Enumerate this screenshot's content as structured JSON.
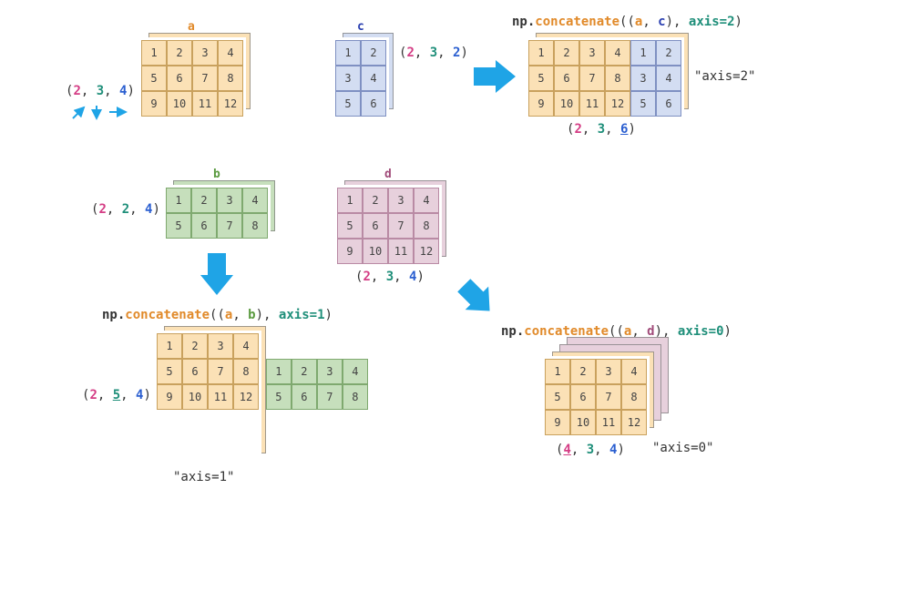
{
  "arrays": {
    "a": {
      "label": "a",
      "rows": 3,
      "cols": 4,
      "depth": 2,
      "values": [
        [
          1,
          2,
          3,
          4
        ],
        [
          5,
          6,
          7,
          8
        ],
        [
          9,
          10,
          11,
          12
        ]
      ],
      "shape": [
        2,
        3,
        4
      ],
      "color": "orange"
    },
    "c": {
      "label": "c",
      "rows": 3,
      "cols": 2,
      "depth": 2,
      "values": [
        [
          1,
          2
        ],
        [
          3,
          4
        ],
        [
          5,
          6
        ]
      ],
      "shape": [
        2,
        3,
        2
      ],
      "color": "blue"
    },
    "b": {
      "label": "b",
      "rows": 2,
      "cols": 4,
      "depth": 2,
      "values": [
        [
          1,
          2,
          3,
          4
        ],
        [
          5,
          6,
          7,
          8
        ]
      ],
      "shape": [
        2,
        2,
        4
      ],
      "color": "green"
    },
    "d": {
      "label": "d",
      "rows": 3,
      "cols": 4,
      "depth": 2,
      "values": [
        [
          1,
          2,
          3,
          4
        ],
        [
          5,
          6,
          7,
          8
        ],
        [
          9,
          10,
          11,
          12
        ]
      ],
      "shape": [
        2,
        3,
        4
      ],
      "color": "pink"
    }
  },
  "ops": {
    "axis2": {
      "code": {
        "module": "np",
        "func": "concatenate",
        "args": [
          "a",
          "c"
        ],
        "kw": "axis",
        "kwval": "2"
      },
      "result_shape": [
        2,
        3,
        6
      ],
      "highlight_index": 2,
      "caption": "\"axis=2\""
    },
    "axis1": {
      "code": {
        "module": "np",
        "func": "concatenate",
        "args": [
          "a",
          "b"
        ],
        "kw": "axis",
        "kwval": "1"
      },
      "result_shape": [
        2,
        5,
        4
      ],
      "highlight_index": 1,
      "caption": "\"axis=1\""
    },
    "axis0": {
      "code": {
        "module": "np",
        "func": "concatenate",
        "args": [
          "a",
          "d"
        ],
        "kw": "axis",
        "kwval": "0"
      },
      "result_shape": [
        4,
        3,
        4
      ],
      "highlight_index": 0,
      "caption": "\"axis=0\""
    }
  },
  "shape_arrows_desc": "arrows showing depth/row/col directions for shape of a"
}
